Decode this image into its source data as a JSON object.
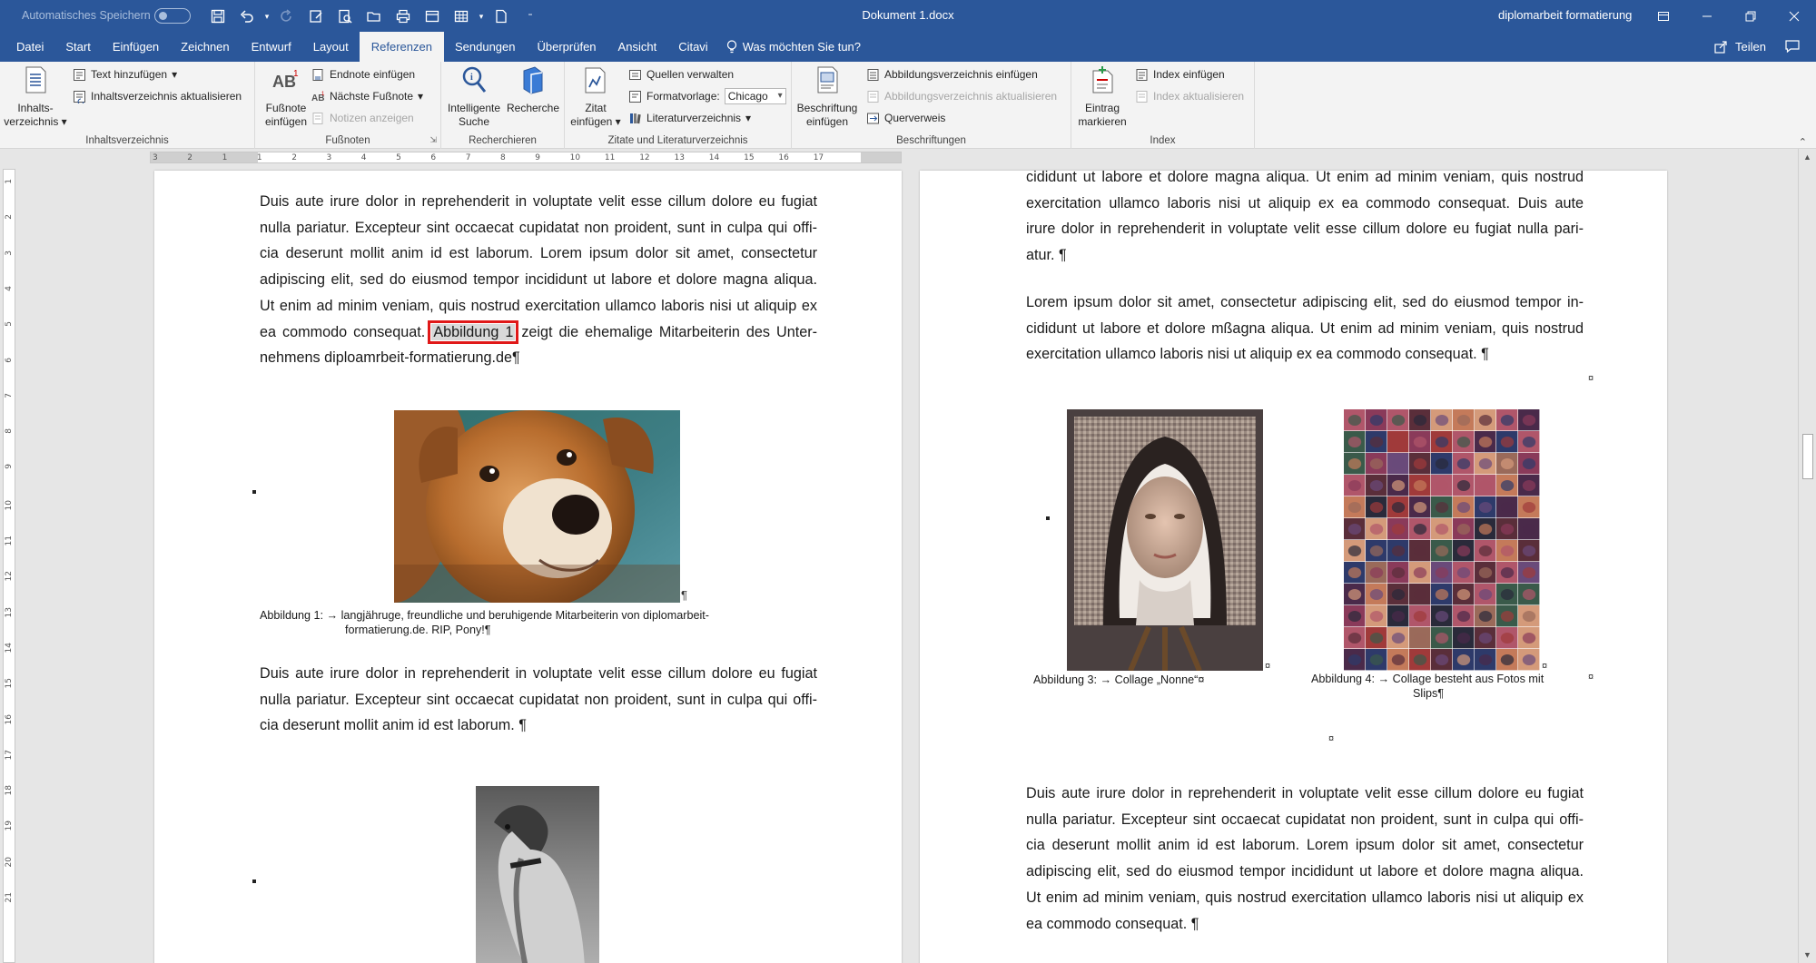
{
  "titlebar": {
    "autosave_label": "Automatisches Speichern",
    "document_title": "Dokument 1.docx",
    "account_name": "diplomarbeit formatierung"
  },
  "tabs": [
    "Datei",
    "Start",
    "Einfügen",
    "Zeichnen",
    "Entwurf",
    "Layout",
    "Referenzen",
    "Sendungen",
    "Überprüfen",
    "Ansicht",
    "Citavi"
  ],
  "active_tab": "Referenzen",
  "tellme_placeholder": "Was möchten Sie tun?",
  "share_label": "Teilen",
  "ribbon": {
    "toc": {
      "label": "Inhaltsverzeichnis",
      "big_button": [
        "Inhalts-",
        "verzeichnis"
      ],
      "add_text": "Text hinzufügen",
      "update_toc": "Inhaltsverzeichnis aktualisieren"
    },
    "footnotes": {
      "label": "Fußnoten",
      "big_button": [
        "Fußnote",
        "einfügen"
      ],
      "insert_endnote": "Endnote einfügen",
      "next_footnote": "Nächste Fußnote",
      "show_notes": "Notizen anzeigen"
    },
    "research": {
      "label": "Recherchieren",
      "smart_lookup": [
        "Intelligente",
        "Suche"
      ],
      "researcher": "Recherche"
    },
    "citations": {
      "label": "Zitate und Literaturverzeichnis",
      "insert_citation": [
        "Zitat",
        "einfügen"
      ],
      "manage_sources": "Quellen verwalten",
      "style_label": "Formatvorlage:",
      "style_value": "Chicago",
      "bibliography": "Literaturverzeichnis"
    },
    "captions": {
      "label": "Beschriftungen",
      "insert_caption": [
        "Beschriftung",
        "einfügen"
      ],
      "insert_tof": "Abbildungsverzeichnis einfügen",
      "update_tof": "Abbildungsverzeichnis aktualisieren",
      "cross_reference": "Querverweis"
    },
    "index": {
      "label": "Index",
      "mark_entry": [
        "Eintrag",
        "markieren"
      ],
      "insert_index": "Index einfügen",
      "update_index": "Index aktualisieren"
    }
  },
  "ruler": {
    "ticks": [
      "3",
      "2",
      "1",
      "1",
      "2",
      "3",
      "4",
      "5",
      "6",
      "7",
      "8",
      "9",
      "10",
      "11",
      "12",
      "13",
      "14",
      "15",
      "16",
      "17"
    ],
    "vticks": [
      "1",
      "2",
      "3",
      "4",
      "5",
      "6",
      "7",
      "8",
      "9",
      "10",
      "11",
      "12",
      "13",
      "14",
      "15",
      "16",
      "17",
      "18",
      "19",
      "20",
      "21"
    ]
  },
  "page1": {
    "para1_lines": [
      "Duis aute irure dolor in reprehenderit in voluptate velit esse cillum dolore eu fugiat",
      "nulla pariatur. Excepteur sint occaecat cupidatat non proident, sunt in culpa qui offi-",
      "cia deserunt mollit anim id est laborum. Lorem ipsum dolor sit amet, consectetur",
      "adipiscing elit, sed do eiusmod tempor incididunt ut labore et dolore magna aliqua.",
      "Ut enim ad minim veniam, quis nostrud exercitation ullamco laboris nisi ut aliquip ex"
    ],
    "para1_line6_before": "ea commodo consequat. ",
    "para1_field": "Abbildung 1",
    "para1_line6_after": " zeigt die ehemalige Mitarbeiterin des Unter-",
    "para1_line7": "nehmens diploamrbeit-formatierung.de¶",
    "figure1_pilcrow": "¶",
    "caption1_line1": "Abbildung 1: → langjähruge, freundliche und beruhigende Mitarbeiterin von diplomarbeit-",
    "caption1_line2": "formatierung.de. RIP, Pony!¶",
    "para2_lines": [
      "Duis aute irure dolor in reprehenderit in voluptate velit esse cillum dolore eu fugiat",
      "nulla pariatur. Excepteur sint occaecat cupidatat non proident, sunt in culpa qui offi-"
    ],
    "para2_last": "cia deserunt mollit anim id est laborum. ¶"
  },
  "page2": {
    "para1_lines": [
      "cididunt ut labore et dolore magna aliqua. Ut enim ad minim veniam, quis nostrud",
      "exercitation ullamco laboris nisi ut aliquip ex ea commodo consequat. Duis aute",
      "irure dolor in reprehenderit in voluptate velit esse cillum dolore eu fugiat nulla pari-"
    ],
    "para1_last": "atur. ¶",
    "para2_lines": [
      "Lorem ipsum dolor sit amet, consectetur adipiscing elit, sed do eiusmod tempor in-",
      "cididunt ut labore et dolore mßagna aliqua. Ut enim ad minim veniam, quis nostrud"
    ],
    "para2_last": "exercitation ullamco laboris nisi ut aliquip ex ea commodo consequat. ¶",
    "cell_mark": "¤",
    "caption3": "Abbildung 3: → Collage „Nonne“¤",
    "caption4_line1": "Abbildung 4: → Collage besteht aus Fotos mit",
    "caption4_line2": "Slips¶",
    "para3_lines": [
      "Duis aute irure dolor in reprehenderit in voluptate velit esse cillum dolore eu fugiat",
      "nulla pariatur. Excepteur sint occaecat cupidatat non proident, sunt in culpa qui offi-",
      "cia deserunt mollit anim id est laborum. Lorem ipsum dolor sit amet, consectetur",
      "adipiscing elit, sed do eiusmod tempor incididunt ut labore et dolore magna aliqua.",
      "Ut enim ad minim veniam, quis nostrud exercitation ullamco laboris nisi ut aliquip ex"
    ],
    "para3_last": "ea commodo consequat. ¶"
  },
  "colors": {
    "accent": "#2b579a",
    "ribbon": "#f3f3f3",
    "highlight_box": "#e01818"
  }
}
